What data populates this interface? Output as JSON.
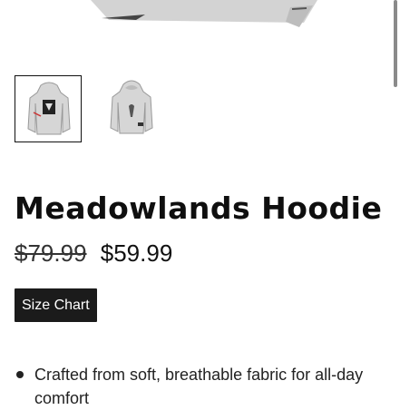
{
  "product": {
    "title": "Meadowlands Hoodie",
    "compare_price": "$79.99",
    "sale_price": "$59.99",
    "size_chart_label": "Size Chart",
    "features": [
      "Crafted from soft, breathable fabric for all-day comfort"
    ]
  },
  "gallery": {
    "thumbnails": [
      {
        "view": "front",
        "active": true
      },
      {
        "view": "back",
        "active": false
      }
    ]
  },
  "colors": {
    "hoodie": "#c9c9c9",
    "button": "#1b1b1b",
    "text": "#111111"
  }
}
